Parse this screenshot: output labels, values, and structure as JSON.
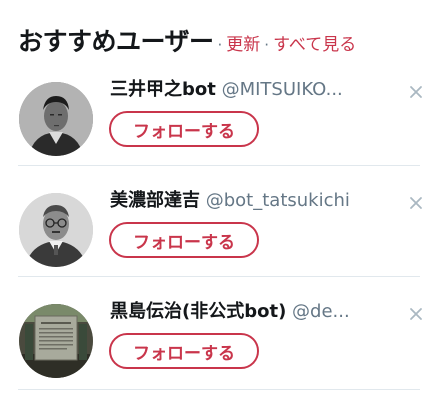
{
  "header": {
    "title": "おすすめユーザー",
    "separator_1": "·",
    "refresh_label": "更新",
    "separator_2": "·",
    "view_all_label": "すべて見る"
  },
  "users": [
    {
      "display_name": "三井甲之bot",
      "handle": "@MITSUIKO...",
      "follow_label": "フォローする",
      "dismiss_icon": "close-icon"
    },
    {
      "display_name": "美濃部達吉",
      "handle": "@bot_tatsukichi",
      "follow_label": "フォローする",
      "dismiss_icon": "close-icon"
    },
    {
      "display_name": "黒島伝治(非公式bot)",
      "handle": "@de...",
      "follow_label": "フォローする",
      "dismiss_icon": "close-icon"
    }
  ],
  "colors": {
    "accent": "#c9354b",
    "name_text": "#14171a",
    "handle_text": "#657786",
    "divider": "#e1e8ed",
    "dismiss_icon": "#aab8c2"
  }
}
